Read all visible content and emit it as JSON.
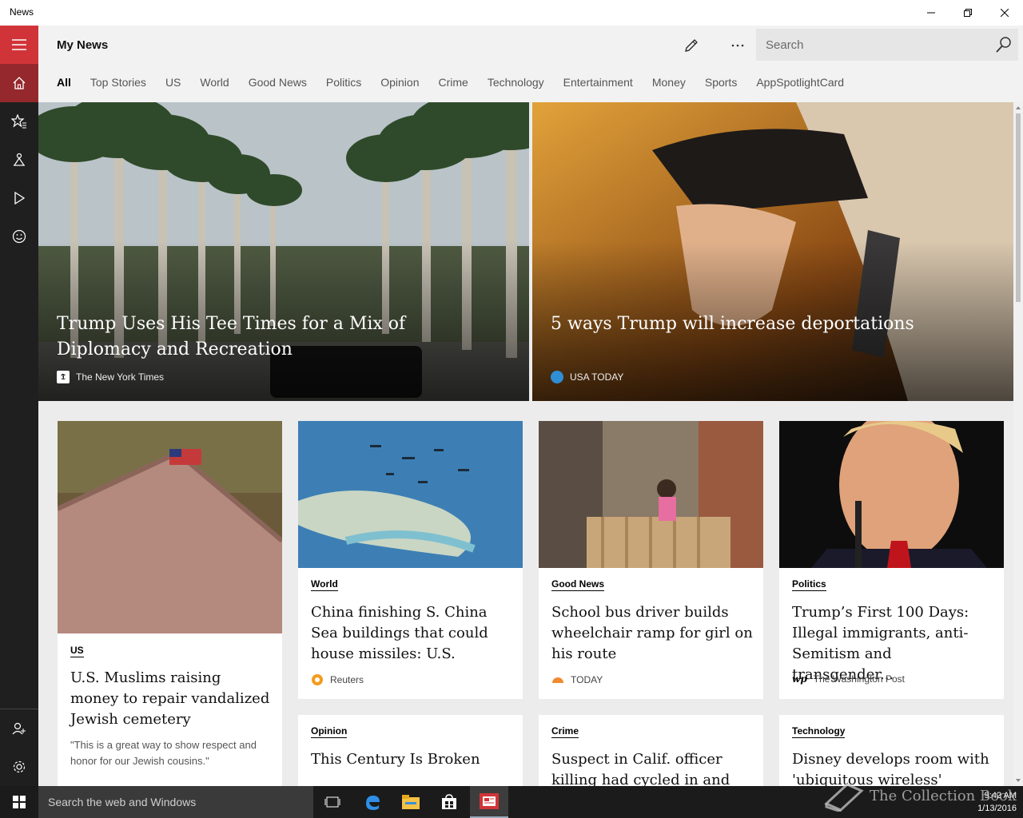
{
  "window": {
    "title": "News"
  },
  "header": {
    "page_title": "My News",
    "search_placeholder": "Search"
  },
  "tabs": [
    {
      "label": "All",
      "active": true
    },
    {
      "label": "Top Stories"
    },
    {
      "label": "US"
    },
    {
      "label": "World"
    },
    {
      "label": "Good News"
    },
    {
      "label": "Politics"
    },
    {
      "label": "Opinion"
    },
    {
      "label": "Crime"
    },
    {
      "label": "Technology"
    },
    {
      "label": "Entertainment"
    },
    {
      "label": "Money"
    },
    {
      "label": "Sports"
    },
    {
      "label": "AppSpotlightCard"
    }
  ],
  "nav_icons": [
    "hamburger-icon",
    "home-icon",
    "favorites-icon",
    "local-icon",
    "video-icon",
    "smiley-icon",
    "account-icon",
    "settings-icon"
  ],
  "hero": [
    {
      "headline": "Trump Uses His Tee Times for a Mix of Diplomacy and Recreation",
      "source": "The New York Times"
    },
    {
      "headline": "5 ways Trump will increase deportations",
      "source": "USA TODAY"
    }
  ],
  "cards": [
    {
      "category": "US",
      "title": "U.S. Muslims raising money to repair vandalized Jewish cemetery",
      "snippet": "\"This is a great way to show respect and honor for our Jewish cousins.\""
    },
    {
      "category": "World",
      "title": "China finishing S. China Sea buildings that could house missiles: U.S.",
      "source": "Reuters"
    },
    {
      "category": "Good News",
      "title": "School bus driver builds wheelchair ramp for girl on his route",
      "source": "TODAY"
    },
    {
      "category": "Politics",
      "title": "Trump’s First 100 Days: Illegal immigrants, anti-Semitism and transgender...",
      "source": "The Washington Post"
    },
    {
      "category": "Opinion",
      "title": "This Century Is Broken"
    },
    {
      "category": "Crime",
      "title": "Suspect in Calif. officer killing had cycled in and out"
    },
    {
      "category": "Technology",
      "title": "Disney develops room with 'ubiquitous wireless'"
    }
  ],
  "taskbar": {
    "search_text": "Search the web and Windows",
    "time": "9:42 AM",
    "date": "1/13/2016"
  },
  "watermark": "The Collection Book",
  "colors": {
    "accent": "#d13438",
    "nav_bg": "#1f1f1f",
    "header_bg": "#f2f2f2"
  }
}
